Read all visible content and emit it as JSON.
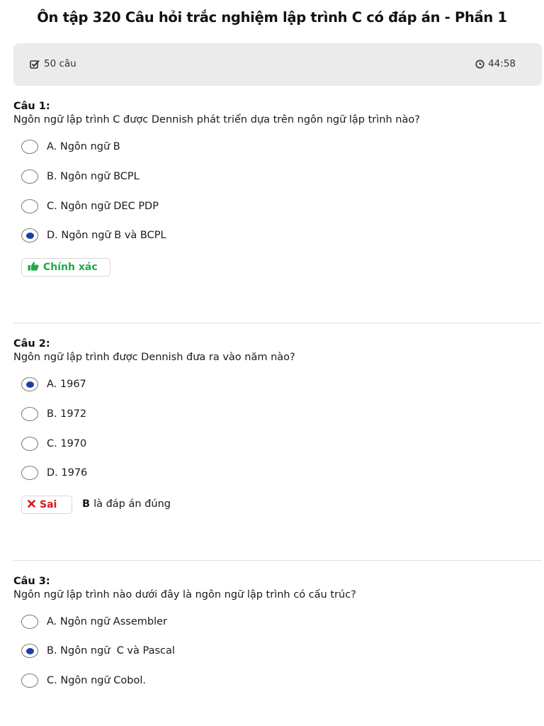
{
  "page": {
    "title": "Ôn tập 320 Câu hỏi trắc nghiệm lập trình C có đáp án - Phần 1"
  },
  "info": {
    "question_count": "50 câu",
    "timer": "44:58"
  },
  "questions": [
    {
      "number": "Câu 1:",
      "text": "Ngôn ngữ lập trình C được Dennish phát triển dựa trên ngôn ngữ lập trình nào?",
      "options": [
        {
          "label": "A. Ngôn ngữ B",
          "selected": false
        },
        {
          "label": "B. Ngôn ngữ BCPL",
          "selected": false
        },
        {
          "label": "C. Ngôn ngữ DEC PDP",
          "selected": false
        },
        {
          "label": "D. Ngôn ngữ B và BCPL",
          "selected": true
        }
      ],
      "result": {
        "status": "correct",
        "label": "Chính xác"
      }
    },
    {
      "number": "Câu 2:",
      "text": "Ngôn ngữ lập trình được Dennish đưa ra vào năm nào?",
      "options": [
        {
          "label": "A. 1967",
          "selected": true
        },
        {
          "label": "B. 1972",
          "selected": false
        },
        {
          "label": "C. 1970",
          "selected": false
        },
        {
          "label": "D. 1976",
          "selected": false
        }
      ],
      "result": {
        "status": "wrong",
        "label": "Sai",
        "correct_answer": "B",
        "correct_note": "là đáp án đúng"
      }
    },
    {
      "number": "Câu 3:",
      "text": "Ngôn ngữ lập trình nào dưới đây là ngôn ngữ lập trình có cấu trúc?",
      "options": [
        {
          "label": "A. Ngôn ngữ Assembler",
          "selected": false
        },
        {
          "label": "B. Ngôn ngữ  C và Pascal",
          "selected": true
        },
        {
          "label": "C. Ngôn ngữ Cobol.",
          "selected": false
        }
      ]
    }
  ],
  "colors": {
    "correct": "#1faa4a",
    "wrong": "#d9141c",
    "radio_selected": "#1a3ea8",
    "info_bar_bg": "#ebebeb"
  }
}
